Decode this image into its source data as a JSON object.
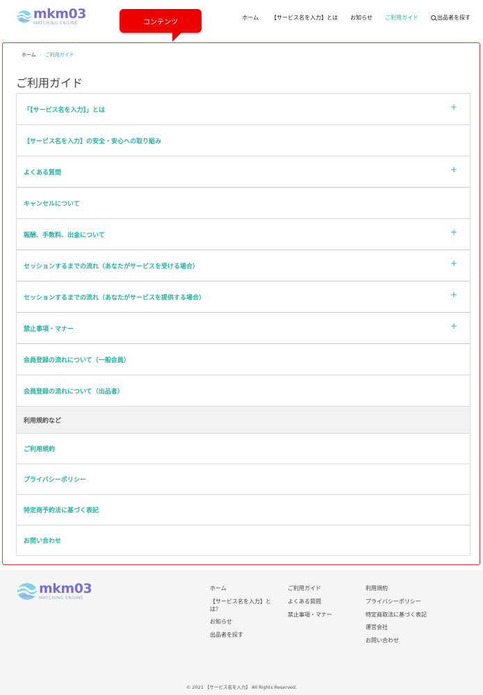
{
  "header": {
    "logo": {
      "name": "mkm03",
      "sub": "MATCHING ENGINE"
    },
    "nav": [
      {
        "label": "ホーム",
        "active": false
      },
      {
        "label": "【サービス名を入力】とは",
        "active": false
      },
      {
        "label": "お知らせ",
        "active": false
      },
      {
        "label": "ご利用ガイド",
        "active": true
      },
      {
        "label": "出品者を探す",
        "active": false,
        "icon": "search-icon"
      }
    ]
  },
  "callout": {
    "label": "コンテンツ",
    "color": "#ee0000"
  },
  "breadcrumb": {
    "home": "ホーム",
    "separator": "›",
    "current": "ご利用ガイド"
  },
  "page_title": "ご利用ガイド",
  "guide": {
    "items": [
      {
        "label": "「【サービス名を入力】」とは",
        "expandable": true
      },
      {
        "label": "【サービス名を入力】の安全・安心への取り組み",
        "expandable": false
      },
      {
        "label": "よくある質問",
        "expandable": true
      },
      {
        "label": "キャンセルについて",
        "expandable": false
      },
      {
        "label": "報酬、手数料、出金について",
        "expandable": true
      },
      {
        "label": "セッションするまでの流れ（あなたがサービスを受ける場合）",
        "expandable": true
      },
      {
        "label": "セッションするまでの流れ（あなたがサービスを提供する場合）",
        "expandable": true
      },
      {
        "label": "禁止事項・マナー",
        "expandable": true
      },
      {
        "label": "会員登録の流れについて（一般会員）",
        "expandable": false
      },
      {
        "label": "会員登録の流れについて（出品者）",
        "expandable": false
      }
    ],
    "plus_symbol": "+",
    "section_header": "利用規約など",
    "terms": [
      {
        "label": "ご利用規約"
      },
      {
        "label": "プライバシーポリシー"
      },
      {
        "label": "特定商予約法に基づく表記"
      },
      {
        "label": "お問い合わせ"
      }
    ]
  },
  "footer": {
    "logo": {
      "name": "mkm03",
      "sub": "MATCHING ENGINE"
    },
    "col1": [
      "ホーム",
      "【サービス名を入力】とは？",
      "お知らせ",
      "出品者を探す"
    ],
    "col2": [
      "ご利用ガイド",
      "よくある質問",
      "禁止事項・マナー"
    ],
    "col3": [
      "利用規約",
      "プライバシーポリシー",
      "特定商取法に基づく表記",
      "運営会社",
      "お問い合わせ"
    ],
    "copyright": "© 2021 【サービス名を入力】 All Rights Reserved."
  },
  "colors": {
    "accent": "#2bb3a3",
    "brand": "#7b6fc9",
    "frame": "#e33333"
  }
}
